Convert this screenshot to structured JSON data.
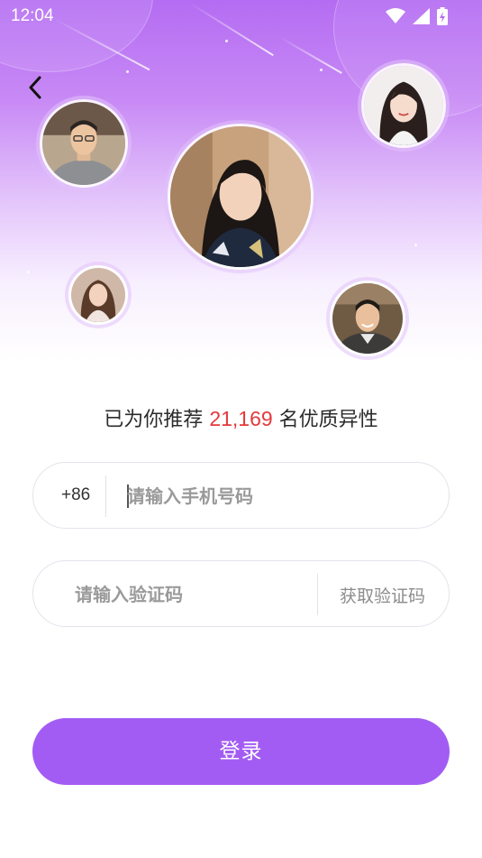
{
  "status_bar": {
    "time": "12:04",
    "icons": [
      "wifi-icon",
      "signal-icon",
      "battery-charging-icon"
    ]
  },
  "nav": {
    "back_icon": "chevron-left-icon"
  },
  "avatars": [
    {
      "name": "avatar-man-glasses",
      "desc": "recommended user"
    },
    {
      "name": "avatar-woman-main",
      "desc": "recommended user"
    },
    {
      "name": "avatar-woman-top-right",
      "desc": "recommended user"
    },
    {
      "name": "avatar-woman-small",
      "desc": "recommended user"
    },
    {
      "name": "avatar-man-smiling",
      "desc": "recommended user"
    }
  ],
  "recommend": {
    "prefix": "已为你推荐",
    "count": "21,169",
    "suffix": "名优质异性"
  },
  "phone": {
    "country_code": "+86",
    "placeholder": "请输入手机号码",
    "value": ""
  },
  "code": {
    "placeholder": "请输入验证码",
    "value": "",
    "get_code_label": "获取验证码"
  },
  "login": {
    "label": "登录"
  },
  "colors": {
    "accent": "#a35cf3",
    "count_red": "#e5393b",
    "hero_top": "#b46cf2"
  }
}
